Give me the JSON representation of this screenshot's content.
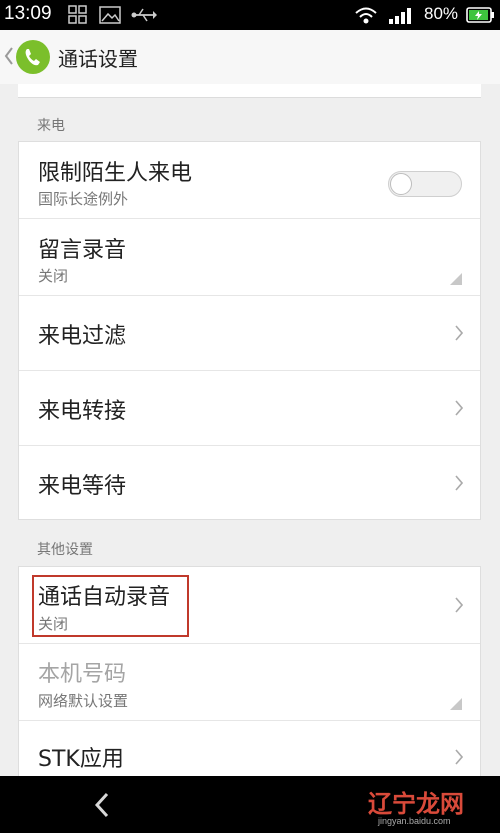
{
  "status_bar": {
    "time": "13:09",
    "battery": "80%"
  },
  "action_bar": {
    "title": "通话设置"
  },
  "sections": {
    "incoming": {
      "header": "来电",
      "items": [
        {
          "label": "限制陌生人来电",
          "sub": "国际长途例外",
          "control": "toggle",
          "on": false
        },
        {
          "label": "留言录音",
          "sub": "关闭",
          "control": "dropdown"
        },
        {
          "label": "来电过滤",
          "control": "chevron"
        },
        {
          "label": "来电转接",
          "control": "chevron"
        },
        {
          "label": "来电等待",
          "control": "chevron"
        }
      ]
    },
    "other": {
      "header": "其他设置",
      "items": [
        {
          "label": "通话自动录音",
          "sub": "关闭",
          "control": "chevron"
        },
        {
          "label": "本机号码",
          "sub": "网络默认设置",
          "control": "dropdown",
          "disabled": true
        },
        {
          "label": "STK应用",
          "control": "chevron"
        }
      ]
    }
  },
  "watermark": {
    "text": "辽宁龙网",
    "sub": "jingyan.baidu.com"
  },
  "colors": {
    "accent_green": "#7bbf2b",
    "highlight_red": "#c0392b"
  }
}
